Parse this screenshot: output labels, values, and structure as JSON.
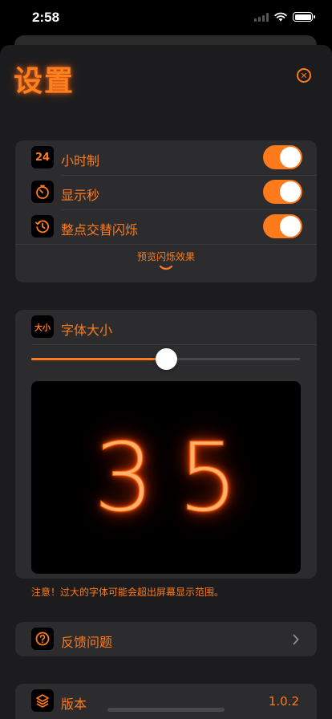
{
  "status_bar": {
    "time": "2:58"
  },
  "header": {
    "title": "设置"
  },
  "toggles_card": {
    "rows": [
      {
        "label": "小时制",
        "icon": "24-hour-icon",
        "icon_text": "24",
        "enabled": true
      },
      {
        "label": "显示秒",
        "icon": "timer-icon",
        "enabled": true
      },
      {
        "label": "整点交替闪烁",
        "icon": "history-clock-icon",
        "enabled": true
      }
    ],
    "preview_label": "预览闪烁效果"
  },
  "font_card": {
    "label": "字体大小",
    "icon_text": "大小",
    "slider_value": 0.5,
    "preview_digits": [
      "3",
      "5"
    ]
  },
  "warning": "注意！过大的字体可能会超出屏幕显示范围。",
  "feedback_row": {
    "label": "反馈问题",
    "icon": "question-icon"
  },
  "version_row": {
    "label": "版本",
    "value": "1.0.2",
    "icon": "layers-icon"
  },
  "colors": {
    "accent": "#ff7a1a",
    "background": "#1c1c1e",
    "card": "#2c2c2e"
  }
}
